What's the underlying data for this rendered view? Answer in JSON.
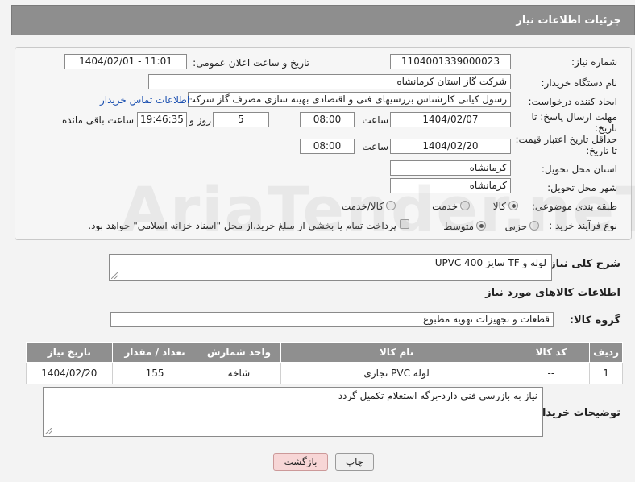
{
  "header": {
    "title": "جزئیات اطلاعات نیاز"
  },
  "form": {
    "need_number": {
      "label": "شماره نیاز:",
      "value": "1104001339000023"
    },
    "announce_datetime": {
      "label": "تاریخ و ساعت اعلان عمومی:",
      "value": "1404/02/01 - 11:01"
    },
    "buyer_org": {
      "label": "نام دستگاه خریدار:",
      "value": "شرکت گاز استان کرمانشاه"
    },
    "creator": {
      "label": "ایجاد کننده درخواست:",
      "value": "رسول کیانی کارشناس بررسیهای فنی و اقتصادی بهینه سازی مصرف گاز شرکت گاز استان کرمانشاه",
      "contact_link": "اطلاعات تماس خریدار"
    },
    "response_deadline": {
      "label_line1": "مهلت ارسال پاسخ: تا",
      "label_line2": "تاریخ:",
      "date": "1404/02/07",
      "time_label": "ساعت",
      "time": "08:00",
      "days": "5",
      "days_label": "روز و",
      "remaining": "19:46:35",
      "remaining_label": "ساعت باقی مانده"
    },
    "price_validity": {
      "label_line1": "حداقل تاریخ اعتبار قیمت:",
      "label_line2": "تا تاریخ:",
      "date": "1404/02/20",
      "time_label": "ساعت",
      "time": "08:00"
    },
    "delivery_province": {
      "label": "استان محل تحویل:",
      "value": "کرمانشاه"
    },
    "delivery_city": {
      "label": "شهر محل تحویل:",
      "value": "کرمانشاه"
    },
    "category": {
      "label": "طبقه بندی موضوعی:",
      "options": [
        "کالا",
        "خدمت",
        "کالا/خدمت"
      ],
      "selected": "کالا"
    },
    "purchase_process": {
      "label": "نوع فرآیند خرید :",
      "options": [
        "جزیی",
        "متوسط"
      ],
      "selected": "متوسط",
      "payment_note": "پرداخت تمام یا بخشی از مبلغ خرید،از محل \"اسناد خزانه اسلامی\" خواهد بود."
    }
  },
  "summary": {
    "label": "شرح کلی نیاز:",
    "value": "لوله و TF سایز 400 UPVC"
  },
  "goods_info": {
    "title": "اطلاعات کالاهای مورد نیاز"
  },
  "goods_group": {
    "label": "گروه کالا:",
    "value": "قطعات و تجهیزات تهویه مطبوع"
  },
  "table": {
    "headers": [
      "ردیف",
      "کد کالا",
      "نام کالا",
      "واحد شمارش",
      "تعداد / مقدار",
      "تاریخ نیاز"
    ],
    "rows": [
      [
        "1",
        "--",
        "لوله PVC تجاری",
        "شاخه",
        "155",
        "1404/02/20"
      ]
    ]
  },
  "buyer_notes": {
    "label": "توضیحات خریدار:",
    "value": "نیاز به بازرسی فنی دارد-برگه استعلام تکمیل گردد"
  },
  "buttons": {
    "print": "چاپ",
    "back": "بازگشت"
  }
}
